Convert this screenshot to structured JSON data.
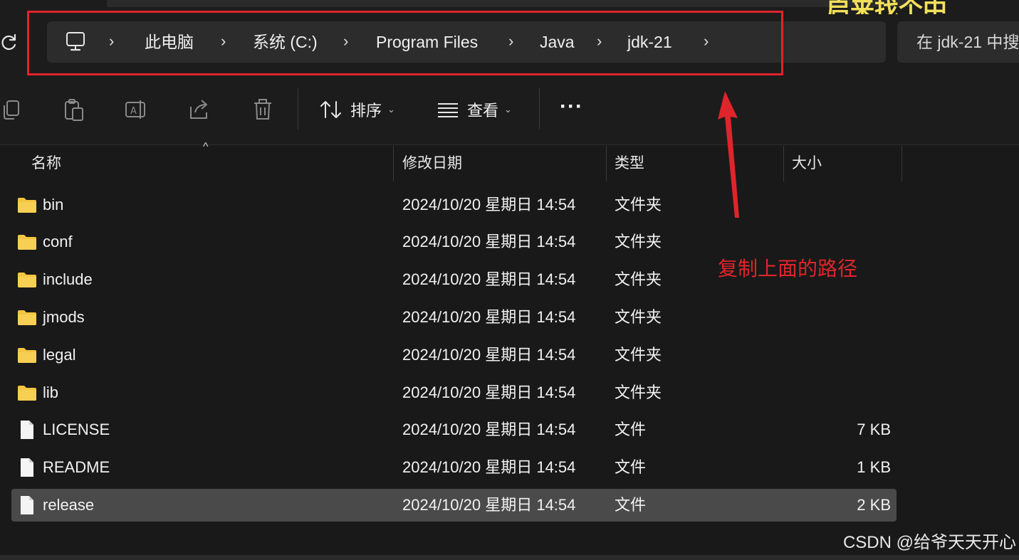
{
  "top_banner_text": "启来找个中",
  "breadcrumb": {
    "items": [
      "此电脑",
      "系统 (C:)",
      "Program Files",
      "Java",
      "jdk-21"
    ],
    "separator": "›"
  },
  "search": {
    "placeholder": "在 jdk-21 中搜"
  },
  "toolbar": {
    "sort_label": "排序",
    "view_label": "查看",
    "more_label": "···"
  },
  "columns": {
    "name": "名称",
    "modified": "修改日期",
    "type": "类型",
    "size": "大小"
  },
  "files": [
    {
      "name": "bin",
      "modified": "2024/10/20 星期日 14:54",
      "type": "文件夹",
      "size": "",
      "kind": "folder"
    },
    {
      "name": "conf",
      "modified": "2024/10/20 星期日 14:54",
      "type": "文件夹",
      "size": "",
      "kind": "folder"
    },
    {
      "name": "include",
      "modified": "2024/10/20 星期日 14:54",
      "type": "文件夹",
      "size": "",
      "kind": "folder"
    },
    {
      "name": "jmods",
      "modified": "2024/10/20 星期日 14:54",
      "type": "文件夹",
      "size": "",
      "kind": "folder"
    },
    {
      "name": "legal",
      "modified": "2024/10/20 星期日 14:54",
      "type": "文件夹",
      "size": "",
      "kind": "folder"
    },
    {
      "name": "lib",
      "modified": "2024/10/20 星期日 14:54",
      "type": "文件夹",
      "size": "",
      "kind": "folder"
    },
    {
      "name": "LICENSE",
      "modified": "2024/10/20 星期日 14:54",
      "type": "文件",
      "size": "7 KB",
      "kind": "file"
    },
    {
      "name": "README",
      "modified": "2024/10/20 星期日 14:54",
      "type": "文件",
      "size": "1 KB",
      "kind": "file"
    },
    {
      "name": "release",
      "modified": "2024/10/20 星期日 14:54",
      "type": "文件",
      "size": "2 KB",
      "kind": "file",
      "selected": true
    }
  ],
  "annotation": {
    "note": "复制上面的路径",
    "color": "#e0242b"
  },
  "watermark": "CSDN @给爷天天开心",
  "colors": {
    "folder": "#f4c542",
    "selection": "#4a4a4a",
    "background": "#191919"
  }
}
